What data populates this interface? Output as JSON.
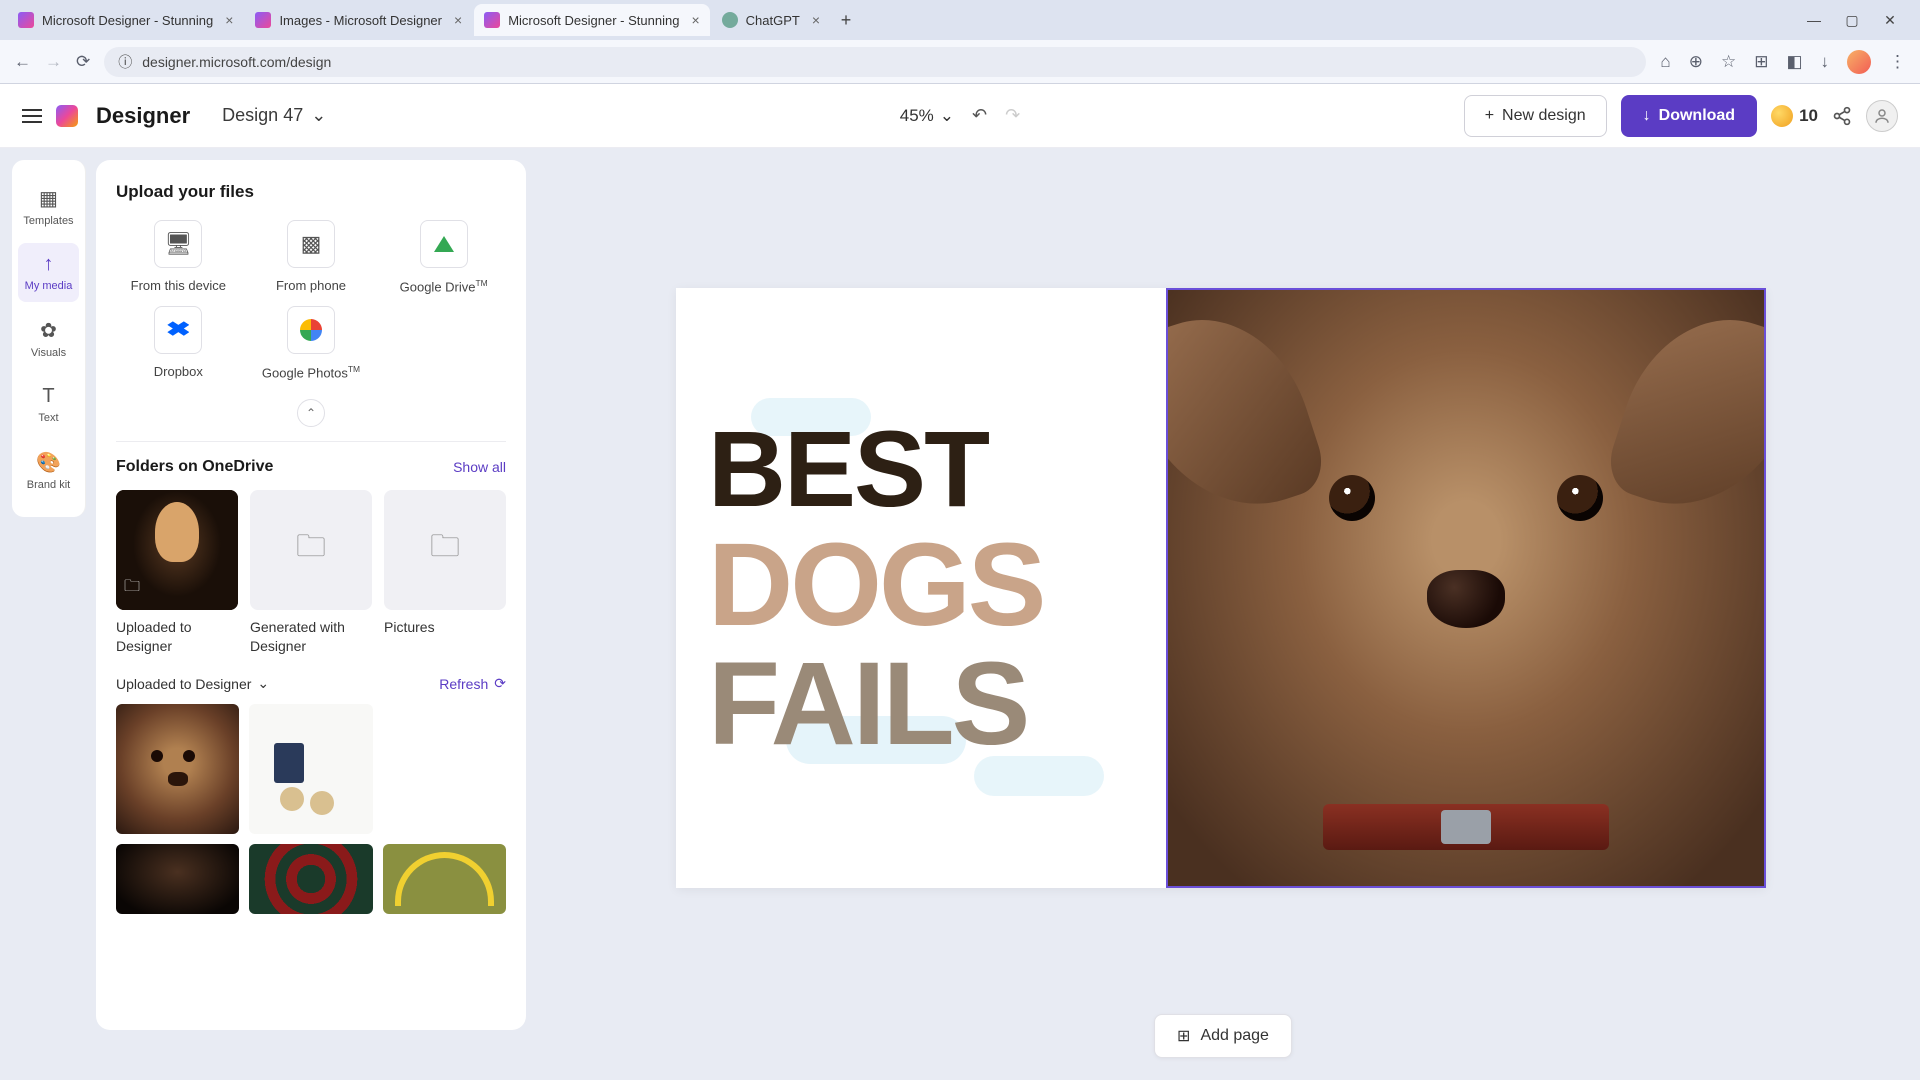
{
  "browser": {
    "tabs": [
      {
        "title": "Microsoft Designer - Stunning",
        "active": false
      },
      {
        "title": "Images - Microsoft Designer",
        "active": false
      },
      {
        "title": "Microsoft Designer - Stunning",
        "active": true
      },
      {
        "title": "ChatGPT",
        "active": false
      }
    ],
    "url": "designer.microsoft.com/design"
  },
  "header": {
    "app_name": "Designer",
    "design_name": "Design 47",
    "zoom": "45%",
    "new_design": "New design",
    "download": "Download",
    "credits": "10"
  },
  "rail": {
    "templates": "Templates",
    "my_media": "My media",
    "visuals": "Visuals",
    "text": "Text",
    "brand_kit": "Brand kit"
  },
  "panel": {
    "upload_title": "Upload your files",
    "from_device": "From this device",
    "from_phone": "From phone",
    "gdrive": "Google Drive",
    "gdrive_tm": "TM",
    "dropbox": "Dropbox",
    "gphotos": "Google Photos",
    "gphotos_tm": "TM",
    "folders_title": "Folders on OneDrive",
    "show_all": "Show all",
    "folders": [
      {
        "label": "Uploaded to Designer"
      },
      {
        "label": "Generated with Designer"
      },
      {
        "label": "Pictures"
      }
    ],
    "uploaded_section": "Uploaded to Designer",
    "refresh": "Refresh"
  },
  "canvas": {
    "line1": "BEST",
    "line2": "DOGS",
    "line3": "FAILS",
    "add_page": "Add page"
  }
}
